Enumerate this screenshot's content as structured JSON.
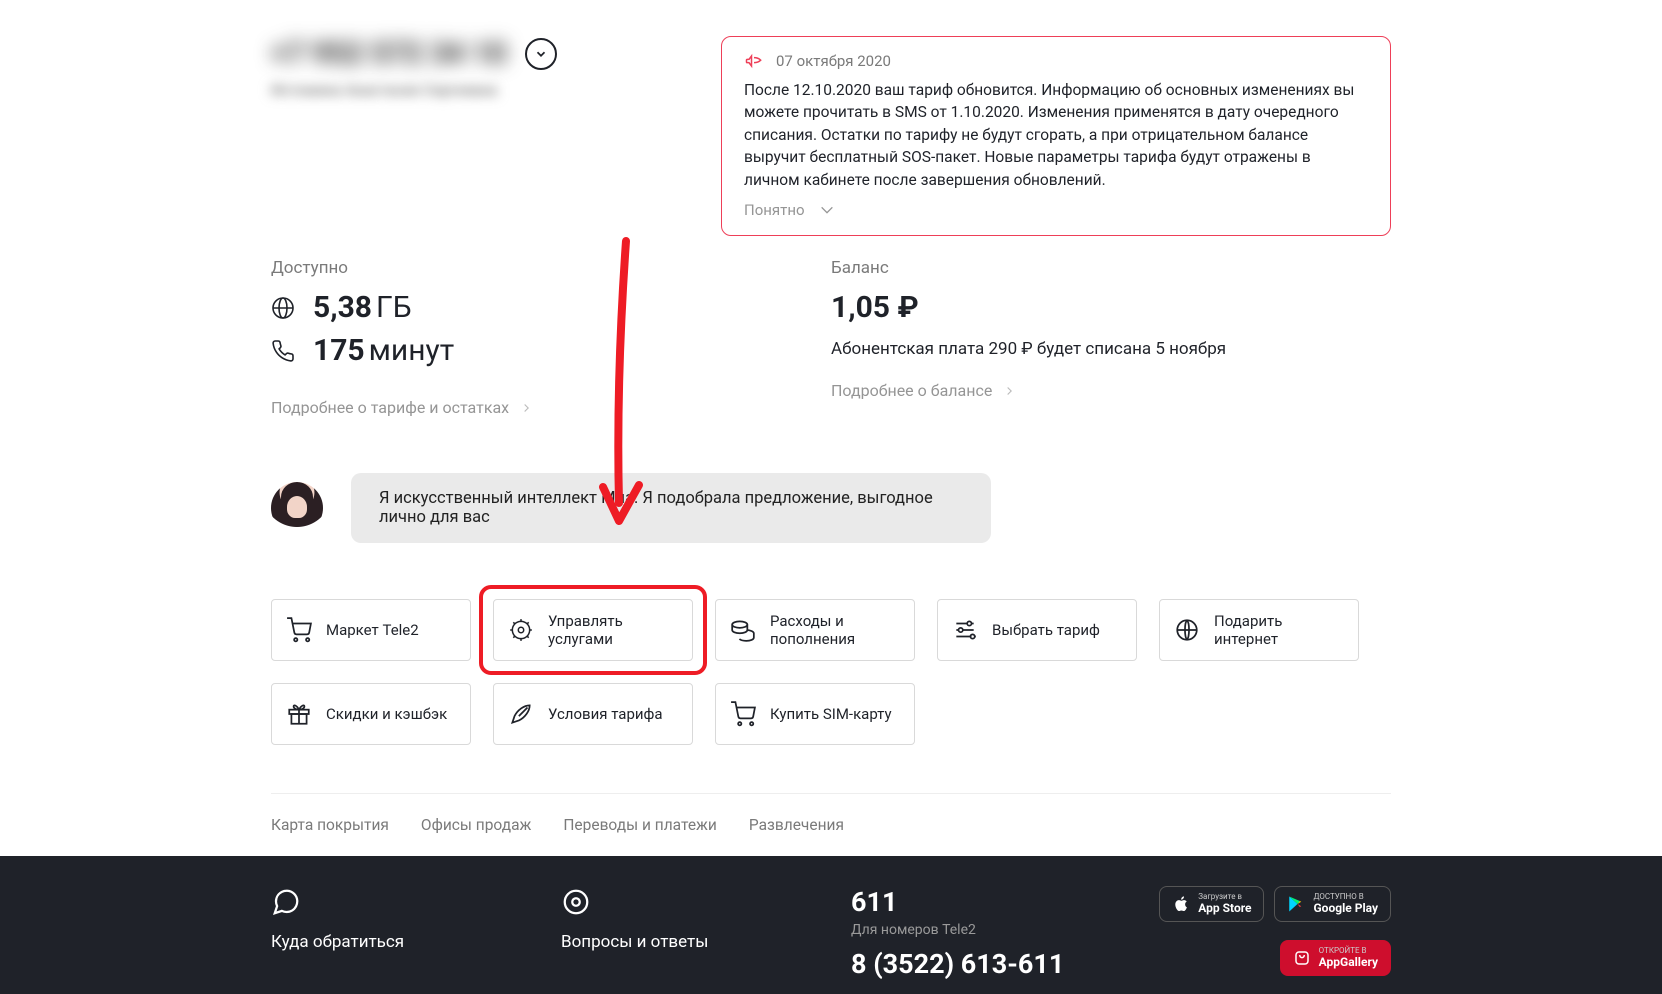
{
  "phone": "+7 952 572 34 10",
  "customerName": "Истомина Анастасия Сергеевна",
  "notice": {
    "date": "07 октября 2020",
    "body": "После 12.10.2020 ваш тариф обновится. Информацию об основных изменениях вы можете прочитать в SMS от 1.10.2020. Изменения применятся в дату очередного списания. Остатки по тарифу не будут сгорать, а при отрицательном балансе выручит бесплатный SOS-пакет. Новые параметры тарифа будут отражены в личном кабинете после завершения обновлений.",
    "ack": "Понятно"
  },
  "available": {
    "label": "Доступно",
    "data": "5,38",
    "dataUnit": "ГБ",
    "minutes": "175",
    "minutesUnit": "минут",
    "more": "Подробнее о тарифе и остатках"
  },
  "balance": {
    "label": "Баланс",
    "value": "1,05 ₽",
    "fee": "Абонентская плата 290 ₽ будет списана 5 ноября",
    "more": "Подробнее о балансе"
  },
  "mia": "Я искусственный интеллект Миа. Я подобрала предложение, выгодное лично для вас",
  "tiles": {
    "market": "Маркет Tele2",
    "services": "Управлять услугами",
    "expenses": "Расходы и пополнения",
    "tariff": "Выбрать тариф",
    "gift": "Подарить интернет",
    "cashback": "Скидки и кэшбэк",
    "conditions": "Условия тарифа",
    "sim": "Купить SIM-карту"
  },
  "footerLinks": {
    "coverage": "Карта покрытия",
    "offices": "Офисы продаж",
    "payments": "Переводы и платежи",
    "fun": "Развлечения"
  },
  "darkFooter": {
    "contact": "Куда обратиться",
    "faq": "Вопросы и ответы",
    "shortNum": "611",
    "shortSub": "Для номеров Tele2",
    "longNum": "8 (3522) 613-611",
    "badges": {
      "appstore_pre": "Загрузите в",
      "appstore": "App Store",
      "gplay_pre": "ДОСТУПНО В",
      "gplay": "Google Play",
      "appgal_pre": "ОТКРОЙТЕ В",
      "appgal": "AppGallery"
    }
  }
}
